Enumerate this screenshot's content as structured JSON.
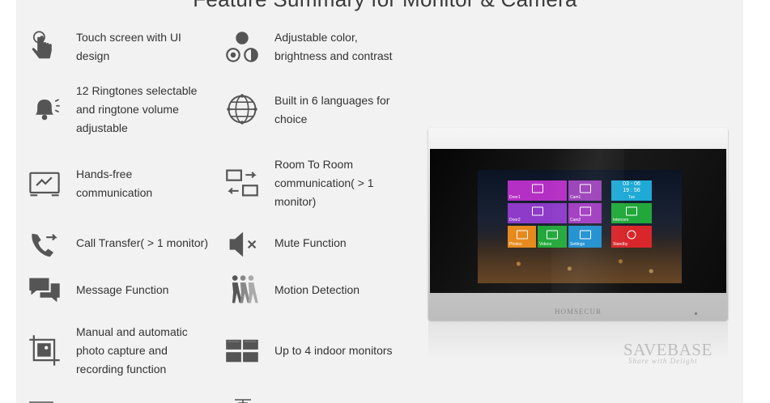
{
  "heading": "Feature Summary for Monitor & Camera",
  "features_left": [
    {
      "icon": "touch-hand-icon",
      "label": "Touch screen with UI design"
    },
    {
      "icon": "bell-icon",
      "label": "12 Ringtones selectable and ringtone volume adjustable"
    },
    {
      "icon": "handsfree-icon",
      "label": "Hands-free communication"
    },
    {
      "icon": "call-transfer-icon",
      "label": "Call Transfer( > 1 monitor)"
    },
    {
      "icon": "message-icon",
      "label": "Message Function"
    },
    {
      "icon": "photo-capture-icon",
      "label": "Manual and automatic photo capture and recording function"
    }
  ],
  "features_right": [
    {
      "icon": "color-adjust-icon",
      "label": "Adjustable color, brightness and contrast"
    },
    {
      "icon": "globe-icon",
      "label": "Built in 6 languages for choice"
    },
    {
      "icon": "room-to-room-icon",
      "label": "Room To Room communication( > 1 monitor)"
    },
    {
      "icon": "mute-icon",
      "label": "Mute Function"
    },
    {
      "icon": "motion-detection-icon",
      "label": "Motion Detection"
    },
    {
      "icon": "multi-monitor-icon",
      "label": "Up to 4 indoor monitors"
    }
  ],
  "monitor": {
    "brand": "HOMSECUR",
    "tiles": [
      {
        "label": "Door1",
        "color": "#b42fc4"
      },
      {
        "label": "Cam1",
        "color": "#9a3fb8"
      },
      {
        "label": "Door2",
        "color": "#8d3bc8"
      },
      {
        "label": "Cam2",
        "color": "#a03ac0"
      },
      {
        "label": "Intercom",
        "color": "#22a83a"
      },
      {
        "label": "Photos",
        "color": "#e68a1e"
      },
      {
        "label": "Videos",
        "color": "#22a83a"
      },
      {
        "label": "Settings",
        "color": "#1d8fd0"
      },
      {
        "label": "Standby",
        "color": "#d8262b"
      }
    ],
    "clock": {
      "date": "03 - 06",
      "time": "19 : 56",
      "day": "Tue",
      "color": "#1ea9d6"
    }
  },
  "watermark": {
    "main": "SAVEBASE",
    "sub": "Share with Delight"
  },
  "colors": {
    "icon": "#555555",
    "panel": "#f2f2f2",
    "text": "#333333"
  }
}
